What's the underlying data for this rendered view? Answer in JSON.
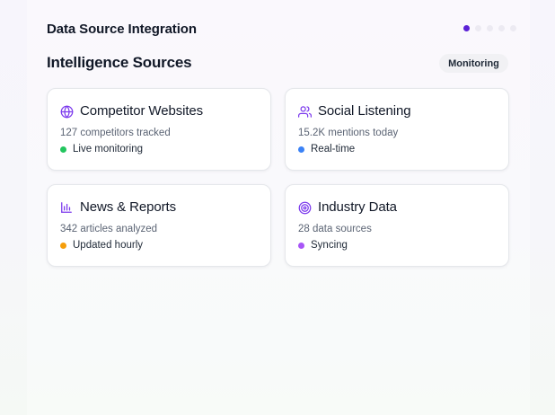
{
  "header": {
    "title": "Data Source Integration"
  },
  "pagination": {
    "total": 5,
    "active": 0,
    "active_color": "#5b21d6"
  },
  "section": {
    "title": "Intelligence Sources",
    "badge": "Monitoring"
  },
  "accent_color": "#7c3aed",
  "cards": [
    {
      "icon": "globe-icon",
      "title": "Competitor Websites",
      "detail": "127 competitors tracked",
      "status": "Live monitoring",
      "status_color": "#22c55e"
    },
    {
      "icon": "users-icon",
      "title": "Social Listening",
      "detail": "15.2K mentions today",
      "status": "Real-time",
      "status_color": "#3b82f6"
    },
    {
      "icon": "bar-chart-icon",
      "title": "News & Reports",
      "detail": "342 articles analyzed",
      "status": "Updated hourly",
      "status_color": "#f59e0b"
    },
    {
      "icon": "target-icon",
      "title": "Industry Data",
      "detail": "28 data sources",
      "status": "Syncing",
      "status_color": "#a855f7"
    }
  ]
}
